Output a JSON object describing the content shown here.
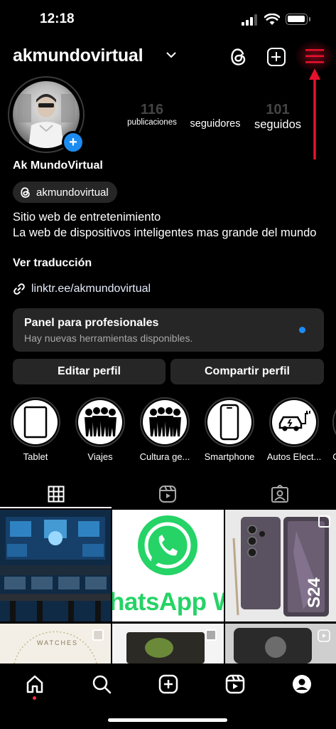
{
  "status_bar": {
    "time": "12:18"
  },
  "header": {
    "username": "akmundovirtual"
  },
  "profile": {
    "stats": [
      {
        "number": "116",
        "label": "publicaciones"
      },
      {
        "number": "",
        "label": "seguidores"
      },
      {
        "number": "101",
        "label": "seguidos"
      }
    ],
    "display_name": "Ak MundoVirtual",
    "threads_handle": "akmundovirtual",
    "bio_line_1": "Sitio web de entretenimiento",
    "bio_line_2": "La web de dispositivos inteligentes mas grande del mundo",
    "translate_label": "Ver traducción",
    "link": "linktr.ee/akmundovirtual"
  },
  "panel": {
    "title": "Panel para profesionales",
    "subtitle": "Hay nuevas herramientas disponibles."
  },
  "buttons": {
    "edit": "Editar perfil",
    "share": "Compartir perfil"
  },
  "highlights": [
    {
      "label": "Tablet",
      "icon": "tablet-icon"
    },
    {
      "label": "Viajes",
      "icon": "people-icon"
    },
    {
      "label": "Cultura ge...",
      "icon": "people-icon"
    },
    {
      "label": "Smartphone",
      "icon": "smartphone-icon"
    },
    {
      "label": "Autos Elect...",
      "icon": "electric-car-icon"
    },
    {
      "label": "C",
      "icon": "partial"
    }
  ],
  "grid_posts": [
    {
      "text": "",
      "kind": "futuristic-office"
    },
    {
      "text": "hatsApp W",
      "kind": "whatsapp"
    },
    {
      "text": "S24",
      "kind": "samsung-phone"
    },
    {
      "text": "WATCHES",
      "kind": "watches"
    },
    {
      "text": "",
      "kind": "food"
    },
    {
      "text": "",
      "kind": "ipad"
    }
  ],
  "colors": {
    "accent_blue": "#1d8cf0",
    "annotation_red": "#e8112d",
    "whatsapp_green": "#25d366",
    "chip_bg": "#262626"
  }
}
